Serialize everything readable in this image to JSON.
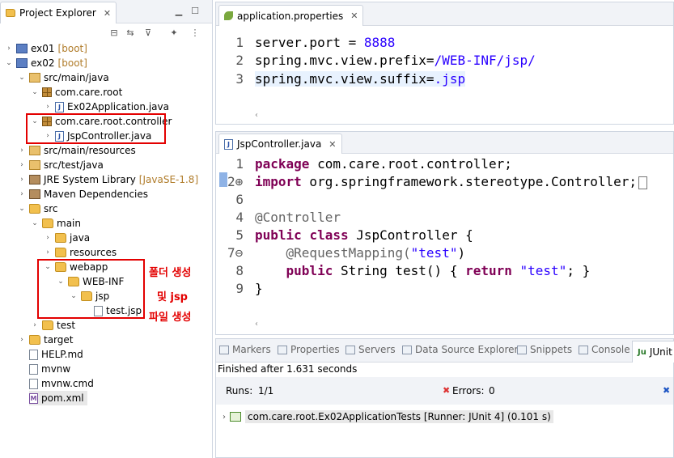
{
  "project_explorer": {
    "title": "Project Explorer",
    "close": "✕",
    "tree": [
      {
        "label": "ex01",
        "suffix": "[boot]"
      },
      {
        "label": "ex02",
        "suffix": "[boot]"
      },
      {
        "label": "src/main/java"
      },
      {
        "label": "com.care.root"
      },
      {
        "label": "Ex02Application.java"
      },
      {
        "label": "com.care.root.controller"
      },
      {
        "label": "JspController.java"
      },
      {
        "label": "src/main/resources"
      },
      {
        "label": "src/test/java"
      },
      {
        "label": "JRE System Library",
        "suffix": "[JavaSE-1.8]"
      },
      {
        "label": "Maven Dependencies"
      },
      {
        "label": "src"
      },
      {
        "label": "main"
      },
      {
        "label": "java"
      },
      {
        "label": "resources"
      },
      {
        "label": "webapp"
      },
      {
        "label": "WEB-INF"
      },
      {
        "label": "jsp"
      },
      {
        "label": "test.jsp"
      },
      {
        "label": "test"
      },
      {
        "label": "target"
      },
      {
        "label": "HELP.md"
      },
      {
        "label": "mvnw"
      },
      {
        "label": "mvnw.cmd"
      },
      {
        "label": "pom.xml"
      }
    ],
    "annotation": [
      "폴더 생성",
      "및 jsp",
      "파일 생성"
    ]
  },
  "editor1": {
    "tab": "application.properties",
    "close": "✕",
    "line_numbers": [
      "1",
      "2",
      "3"
    ],
    "lines": [
      {
        "key": "server.port ",
        "eq": "= ",
        "value": "8888"
      },
      {
        "key": "spring.mvc.view.prefix",
        "eq": "=",
        "value": "/WEB-INF/jsp/"
      },
      {
        "key": "spring.mvc.view.suffix",
        "eq": "=",
        "value": ".jsp"
      }
    ]
  },
  "editor2": {
    "tab": "JspController.java",
    "close": "✕",
    "line_numbers": [
      "1",
      "2⊕",
      "4",
      "5",
      "6",
      "7⊖",
      "8",
      "9"
    ],
    "code": {
      "l1_kw": "package",
      "l1_rest": " com.care.root.controller;",
      "l2_kw": "import",
      "l2_rest": " org.springframework.stereotype.Controller;",
      "l5_ann": "@Controller",
      "l6_kw1": "public",
      "l6_kw2": "class",
      "l6_rest": " JspController {",
      "l7_ann": "    @RequestMapping(",
      "l7_str": "\"test\"",
      "l7_end": ")",
      "l8_kw1": "    public",
      "l8_mid": " String test() { ",
      "l8_kw2": "return",
      "l8_str": " \"test\"",
      "l8_end": "; }",
      "l9": "}"
    }
  },
  "bottom_panel": {
    "tabs": [
      "Markers",
      "Properties",
      "Servers",
      "Data Source Explorer",
      "Snippets",
      "Console",
      "JUnit"
    ],
    "status": "Finished after 1.631 seconds",
    "runs_label": "Runs:",
    "runs_value": "1/1",
    "errors_label": "Errors:",
    "errors_value": "0",
    "test_result": "com.care.root.Ex02ApplicationTests [Runner: JUnit 4] (0.101 s)"
  }
}
